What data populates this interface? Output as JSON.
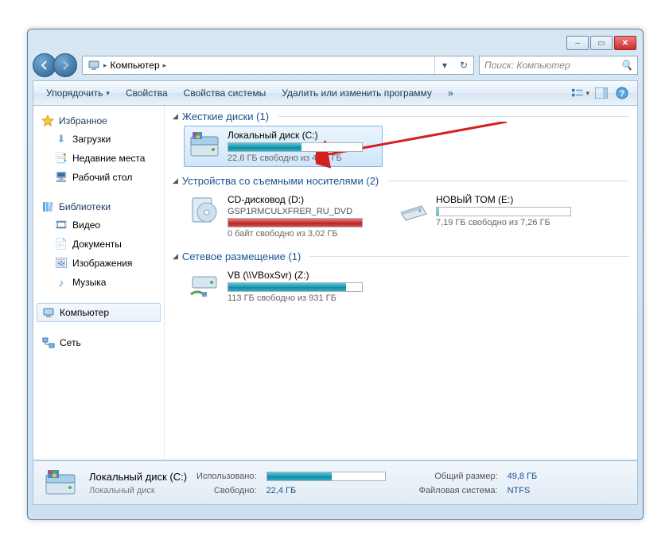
{
  "window": {
    "min": "–",
    "max": "▭",
    "close": "✕"
  },
  "breadcrumb": {
    "root_icon": "computer",
    "root": "Компьютер",
    "sep": "▸"
  },
  "addrtools": {
    "dropdown": "▾",
    "refresh": "↻"
  },
  "search": {
    "placeholder": "Поиск: Компьютер",
    "icon": "🔍"
  },
  "toolbar": {
    "organize": "Упорядочить",
    "properties": "Свойства",
    "sysprops": "Свойства системы",
    "uninstall": "Удалить или изменить программу",
    "chevron": "»"
  },
  "sidebar": {
    "fav": {
      "label": "Избранное",
      "items": [
        {
          "icon": "⬇",
          "label": "Загрузки",
          "color": "#7aa7d4"
        },
        {
          "icon": "📑",
          "label": "Недавние места",
          "color": "#c9a339"
        },
        {
          "icon": "🖥",
          "label": "Рабочий стол",
          "color": "#3a6ea5"
        }
      ]
    },
    "lib": {
      "label": "Библиотеки",
      "items": [
        {
          "icon": "🎞",
          "label": "Видео",
          "color": "#3a6ea5"
        },
        {
          "icon": "📄",
          "label": "Документы",
          "color": "#3a6ea5"
        },
        {
          "icon": "🖼",
          "label": "Изображения",
          "color": "#3a6ea5"
        },
        {
          "icon": "♪",
          "label": "Музыка",
          "color": "#3a8bd4"
        }
      ]
    },
    "computer": "Компьютер",
    "network": "Сеть"
  },
  "sections": {
    "hdd": {
      "title": "Жесткие диски (1)",
      "drives": [
        {
          "name": "Локальный диск (C:)",
          "stat": "22,6 ГБ свободно из 49,8 ГБ",
          "fill": 55,
          "sel": true,
          "icon": "hdd"
        }
      ]
    },
    "removable": {
      "title": "Устройства со съемными носителями (2)",
      "drives": [
        {
          "name": "CD-дисковод (D:)",
          "sub": "GSP1RMCULXFRER_RU_DVD",
          "stat": "0 байт свободно из 3,02 ГБ",
          "fill": 100,
          "icon": "dvd",
          "full": true
        },
        {
          "name": "НОВЫЙ ТОМ (E:)",
          "stat": "7,19 ГБ свободно из 7,26 ГБ",
          "fill": 2,
          "icon": "ext",
          "lite": true
        }
      ]
    },
    "network": {
      "title": "Сетевое размещение (1)",
      "drives": [
        {
          "name": "VB (\\\\VBoxSvr) (Z:)",
          "stat": "113 ГБ свободно из 931 ГБ",
          "fill": 88,
          "icon": "net"
        }
      ]
    }
  },
  "status": {
    "title": "Локальный диск (C:)",
    "sub": "Локальный диск",
    "used_k": "Использовано:",
    "free_k": "Свободно:",
    "free_v": "22,4 ГБ",
    "total_k": "Общий размер:",
    "total_v": "49,8 ГБ",
    "fs_k": "Файловая система:",
    "fs_v": "NTFS",
    "fill": 55
  }
}
